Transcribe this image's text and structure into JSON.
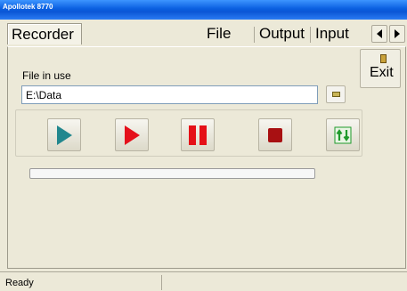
{
  "window": {
    "title": "Apollotek 8770"
  },
  "tabs": [
    {
      "label": "Recorder"
    },
    {
      "label": "File"
    },
    {
      "label": "Output"
    },
    {
      "label": "Input"
    }
  ],
  "exit": {
    "label": "Exit"
  },
  "file": {
    "label": "File in use",
    "value": "E:\\Data"
  },
  "controls": {
    "play_icon": "play-icon",
    "record_icon": "record-play-icon",
    "pause_icon": "pause-icon",
    "stop_icon": "stop-icon",
    "updown_icon": "up-down-arrows-icon"
  },
  "colors": {
    "play": "#22878e",
    "record": "#e5101b",
    "stop": "#a81012",
    "updown": "#1f9a2b"
  },
  "progress": {
    "fraction": 0
  },
  "status": {
    "text": "Ready"
  }
}
